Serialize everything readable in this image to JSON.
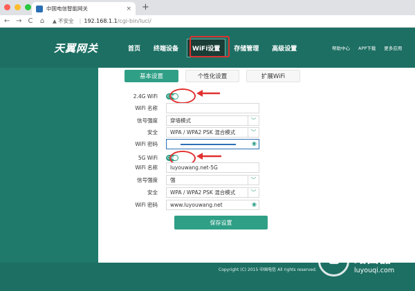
{
  "browser": {
    "tab_title": "中国电信智能网关",
    "tab_close": "×",
    "new_tab": "+",
    "back": "←",
    "forward": "→",
    "reload": "C",
    "home": "⌂",
    "security_warning": "▲ 不安全",
    "url_host": "192.168.1.1",
    "url_path": "/cgi-bin/luci/"
  },
  "header": {
    "logo": "天翼网关",
    "nav": [
      "首页",
      "终端设备",
      "WiFi设置",
      "存储管理",
      "高级设置"
    ],
    "subnav": [
      "帮助中心",
      "APP下载",
      "更多应用"
    ]
  },
  "tabs": [
    "基本设置",
    "个性化设置",
    "扩展WiFi"
  ],
  "form": {
    "wifi24_label": "2.4G WiFi",
    "toggle_on": "ON",
    "name_label": "WiFi 名称",
    "name_24_value": "",
    "signal_label": "信号强度",
    "signal_24_value": "穿墙模式",
    "security_label": "安全",
    "security_24_value": "WPA / WPA2 PSK 混合模式",
    "password_label": "WiFi 密码",
    "password_24_value": "",
    "wifi5_label": "5G WiFi",
    "name_5_value": "luyouwang.net-5G",
    "signal_5_value": "强",
    "security_5_value": "WPA / WPA2 PSK 混合模式",
    "password_5_value": "www.luyouwang.net",
    "save_label": "保存设置"
  },
  "footer": {
    "copyright": "Copyright (C) 2015 中国电信 All rights reserved."
  },
  "watermark": {
    "name": "路由器",
    "url": "luyouqi.com"
  },
  "colors": {
    "brand_green": "#2f9f86",
    "header_green": "#1d6f63",
    "annotation_red": "#e0302f"
  }
}
